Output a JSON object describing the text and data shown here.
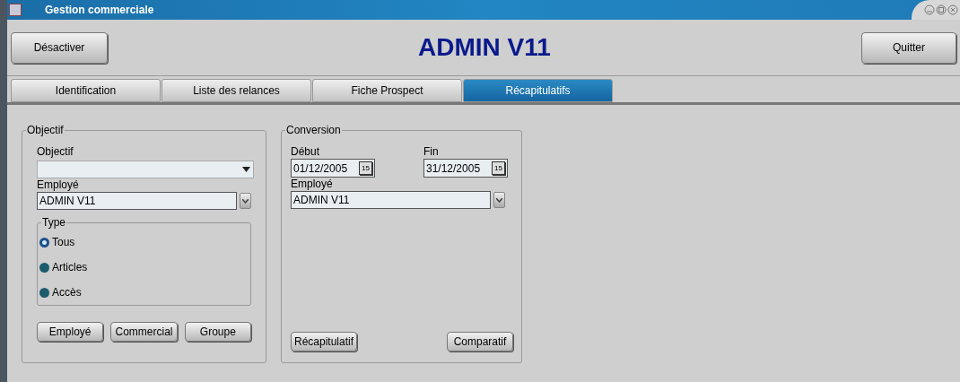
{
  "window": {
    "title": "Gestion commerciale"
  },
  "header": {
    "left_button": "Désactiver",
    "title": "ADMIN V11",
    "right_button": "Quitter"
  },
  "tabs": [
    {
      "label": "Identification",
      "selected": false
    },
    {
      "label": "Liste des relances",
      "selected": false
    },
    {
      "label": "Fiche Prospect",
      "selected": false
    },
    {
      "label": "Récapitulatifs",
      "selected": true
    }
  ],
  "objectif_group": {
    "legend": "Objectif",
    "objectif_label": "Objectif",
    "employe_label": "Employé",
    "employe_value": "ADMIN V11",
    "type": {
      "legend": "Type",
      "options": [
        {
          "label": "Tous",
          "selected": true
        },
        {
          "label": "Articles",
          "selected": false
        },
        {
          "label": "Accès",
          "selected": false
        }
      ]
    },
    "buttons": [
      "Employé",
      "Commercial",
      "Groupe"
    ]
  },
  "conversion_group": {
    "legend": "Conversion",
    "debut_label": "Début",
    "debut_value": "01/12/2005",
    "fin_label": "Fin",
    "fin_value": "31/12/2005",
    "debut_calendar_glyph": "15",
    "fin_calendar_glyph": "15",
    "employe_label": "Employé",
    "employe_value": "ADMIN V11",
    "buttons": [
      "Récapitulatif",
      "Comparatif"
    ]
  }
}
